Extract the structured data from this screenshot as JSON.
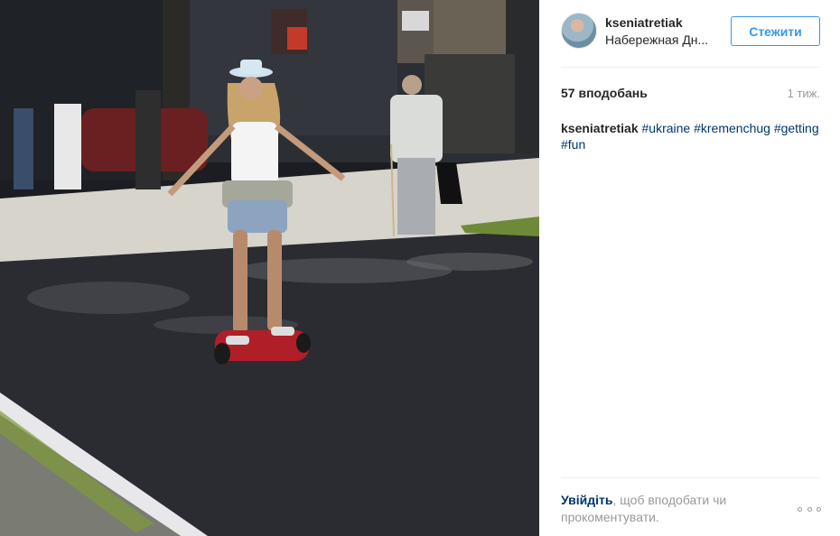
{
  "post": {
    "username": "kseniatretiak",
    "location": "Набережная Дн...",
    "follow_label": "Стежити",
    "likes": "57 вподобань",
    "time_ago": "1 тиж.",
    "caption": {
      "user": "kseniatretiak",
      "tags": [
        "#ukraine",
        "#kremenchug",
        "#getting",
        "#fun"
      ]
    },
    "login_link": "Увійдіть",
    "login_rest": ", щоб вподобати чи прокоментувати."
  },
  "photo": {
    "description_icon": "photo-icon"
  },
  "colors": {
    "accent": "#3897f0",
    "hashtag": "#003569",
    "muted": "#999999"
  }
}
